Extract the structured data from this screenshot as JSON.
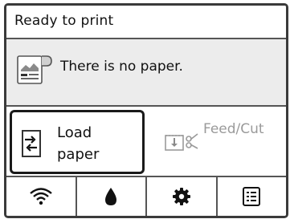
{
  "status": {
    "text": "Ready to print"
  },
  "message": {
    "text": "There is no paper.",
    "icon": "paper-media-icon"
  },
  "buttons": {
    "load_paper": {
      "line1": "Load",
      "line2": "paper",
      "icon": "load-paper-icon"
    },
    "feed_cut": {
      "label": "Feed/Cut",
      "icon": "feed-cut-icon",
      "enabled": false
    }
  },
  "nav": [
    {
      "name": "wifi",
      "icon": "wifi-icon"
    },
    {
      "name": "ink",
      "icon": "ink-drop-icon"
    },
    {
      "name": "settings",
      "icon": "gear-icon"
    },
    {
      "name": "menu",
      "icon": "list-icon"
    }
  ]
}
